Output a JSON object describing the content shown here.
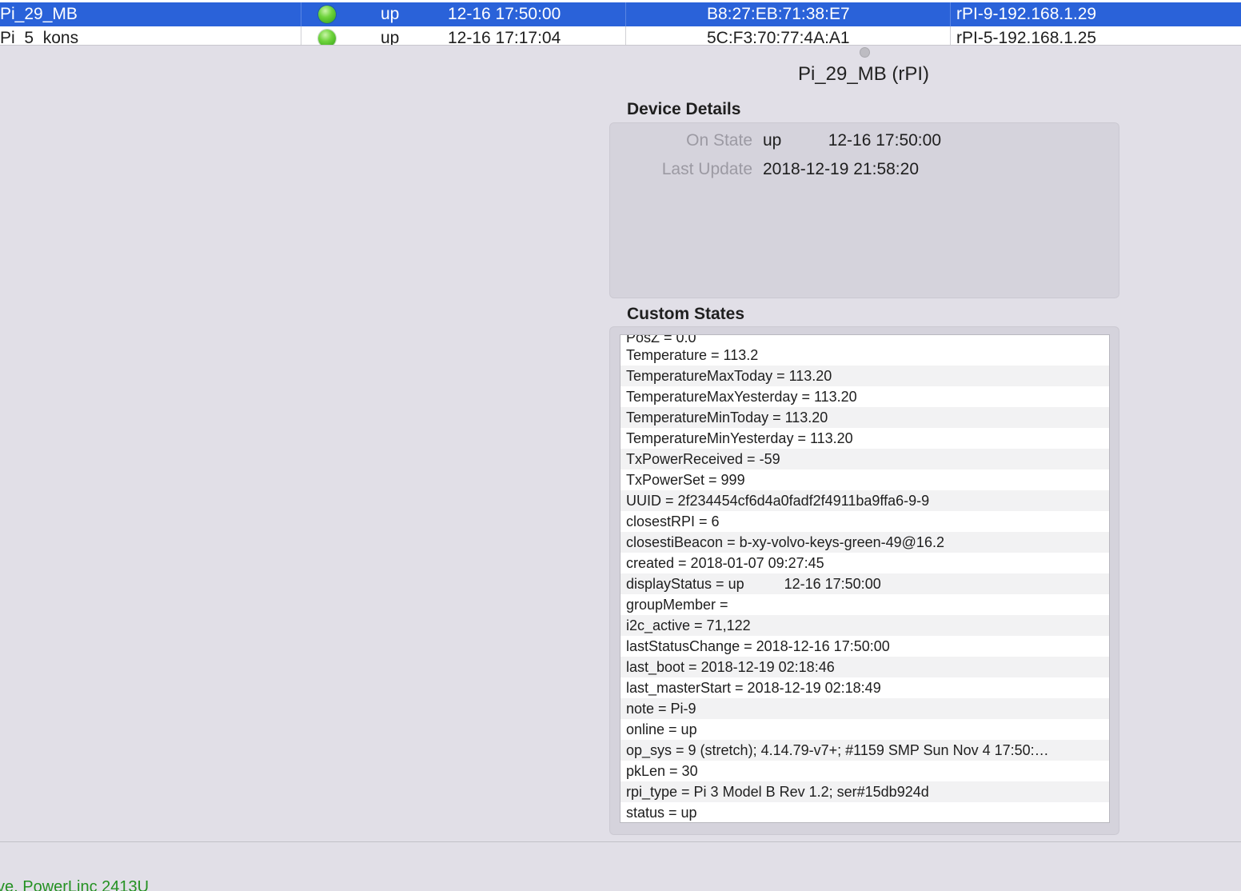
{
  "device_table": {
    "rows": [
      {
        "name": "Pi_29_MB",
        "state": "up",
        "time": "12-16 17:50:00",
        "address": "B8:27:EB:71:38:E7",
        "type": "rPI-9-192.168.1.29"
      },
      {
        "name": "Pi_5_kons",
        "state": "up",
        "time": "12-16 17:17:04",
        "address": "5C:F3:70:77:4A:A1",
        "type": "rPI-5-192.168.1.25"
      }
    ]
  },
  "panel": {
    "title": "Pi_29_MB (rPI)",
    "device_details_heading": "Device Details",
    "on_state_label": "On State",
    "on_state_value": "up          12-16 17:50:00",
    "last_update_label": "Last Update",
    "last_update_value": "2018-12-19 21:58:20",
    "custom_states_heading": "Custom States",
    "custom_states": [
      "PosZ = 0.0",
      "Temperature = 113.2",
      "TemperatureMaxToday = 113.20",
      "TemperatureMaxYesterday = 113.20",
      "TemperatureMinToday = 113.20",
      "TemperatureMinYesterday = 113.20",
      "TxPowerReceived = -59",
      "TxPowerSet = 999",
      "UUID = 2f234454cf6d4a0fadf2f4911ba9ffa6-9-9",
      "closestRPI = 6",
      "closestiBeacon = b-xy-volvo-keys-green-49@16.2",
      "created = 2018-01-07 09:27:45",
      "displayStatus = up          12-16 17:50:00",
      "groupMember = ",
      "i2c_active = 71,122",
      "lastStatusChange = 2018-12-16 17:50:00",
      "last_boot = 2018-12-19 02:18:46",
      "last_masterStart = 2018-12-19 02:18:49",
      "note = Pi-9",
      "online = up",
      "op_sys = 9 (stretch); 4.14.79-v7+; #1159 SMP Sun Nov 4 17:50:…",
      "pkLen = 30",
      "rpi_type = Pi 3 Model B Rev 1.2; ser#15db924d",
      "status = up"
    ]
  },
  "bottom": {
    "interface_text": "ve, PowerLinc 2413U"
  },
  "colors": {
    "selection": "#2a62d9",
    "status_ok": "#3cb521",
    "bottom_text": "#249122"
  }
}
